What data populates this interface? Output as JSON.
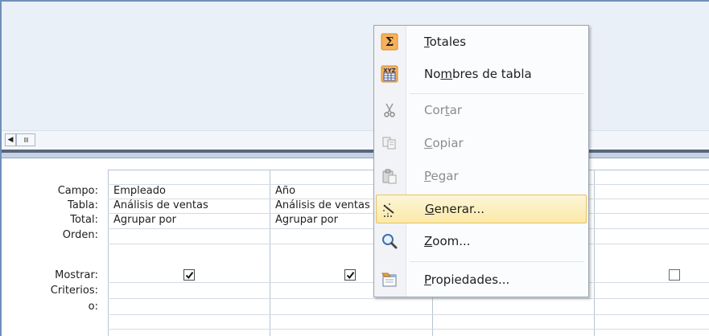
{
  "grid": {
    "row_labels": [
      "Campo:",
      "Tabla:",
      "Total:",
      "Orden:",
      "Mostrar:",
      "Criterios:",
      "o:"
    ],
    "columns": [
      {
        "campo": "Empleado",
        "tabla": "Análisis de ventas",
        "total": "Agrupar por",
        "mostrar": true
      },
      {
        "campo": "Año",
        "tabla": "Análisis de ventas",
        "total": "Agrupar por",
        "mostrar": true
      },
      {
        "campo": "",
        "tabla": "",
        "total": "",
        "mostrar": false
      },
      {
        "campo": "",
        "tabla": "",
        "total": "",
        "mostrar": false
      }
    ]
  },
  "scrollbar": {
    "left_arrow": "◀",
    "thumb": "IIII"
  },
  "context_menu": {
    "items": [
      {
        "pre": "",
        "ul": "T",
        "post": "otales",
        "icon": "sigma-icon",
        "enabled": true
      },
      {
        "pre": "No",
        "ul": "m",
        "post": "bres de tabla",
        "icon": "table-names-icon",
        "enabled": true
      },
      {
        "pre": "Cor",
        "ul": "t",
        "post": "ar",
        "icon": "scissors-icon",
        "enabled": false
      },
      {
        "pre": "",
        "ul": "C",
        "post": "opiar",
        "icon": "copy-icon",
        "enabled": false
      },
      {
        "pre": "",
        "ul": "P",
        "post": "egar",
        "icon": "paste-icon",
        "enabled": false
      },
      {
        "pre": "",
        "ul": "G",
        "post": "enerar...",
        "icon": "wand-icon",
        "enabled": true,
        "highlighted": true
      },
      {
        "pre": "",
        "ul": "Z",
        "post": "oom...",
        "icon": "zoom-icon",
        "enabled": true
      },
      {
        "pre": "",
        "ul": "P",
        "post": "ropiedades...",
        "icon": "properties-icon",
        "enabled": true
      }
    ]
  },
  "colors": {
    "menu_highlight": "#fbe9a8",
    "menu_highlight_border": "#e5c365",
    "splitter": "#58677d",
    "upper_pane": "#eaf0f7"
  }
}
